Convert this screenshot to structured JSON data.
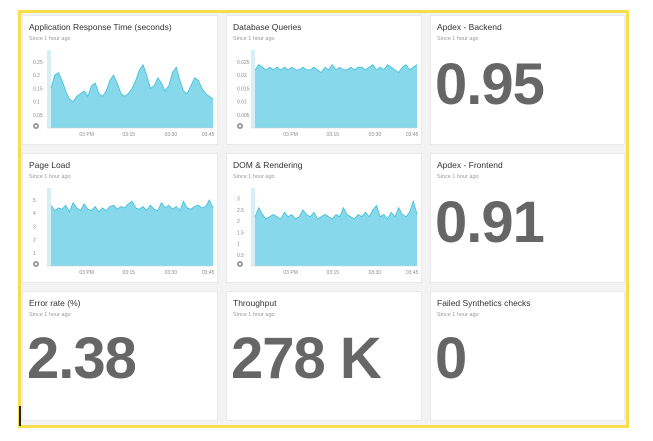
{
  "colors": {
    "area_fill": "#86d8ea",
    "area_stroke": "#2fb9d8",
    "frame": "#f6df4a",
    "big_number": "#666666",
    "gear": "#9a9a9a"
  },
  "widgets": [
    {
      "id": "app-response",
      "title": "Application Response Time (seconds)",
      "subtitle": "Since 1 hour ago",
      "kind": "chart"
    },
    {
      "id": "db-queries",
      "title": "Database Queries",
      "subtitle": "Since 1 hour ago",
      "kind": "chart"
    },
    {
      "id": "apdex-backend",
      "title": "Apdex - Backend",
      "subtitle": "Since 1 hour ago",
      "kind": "number",
      "value": "0.95"
    },
    {
      "id": "page-load",
      "title": "Page Load",
      "subtitle": "Since 1 hour ago",
      "kind": "chart"
    },
    {
      "id": "dom-rendering",
      "title": "DOM & Rendering",
      "subtitle": "Since 1 hour ago",
      "kind": "chart"
    },
    {
      "id": "apdex-frontend",
      "title": "Apdex - Frontend",
      "subtitle": "Since 1 hour ago",
      "kind": "number",
      "value": "0.91"
    },
    {
      "id": "error-rate",
      "title": "Error rate (%)",
      "subtitle": "Since 1 hour ago",
      "kind": "number",
      "value": "2.38"
    },
    {
      "id": "throughput",
      "title": "Throughput",
      "subtitle": "Since 1 hour ago",
      "kind": "number",
      "value": "278 K"
    },
    {
      "id": "failed-synthetics",
      "title": "Failed Synthetics checks",
      "subtitle": "Since 1 hour ago",
      "kind": "number",
      "value": "0"
    }
  ],
  "chart_data": [
    {
      "type": "area",
      "widget": "app-response",
      "x_ticks": [
        "03 PM",
        "03:15",
        "03:30",
        "03:45"
      ],
      "y_ticks": [
        "0.25",
        "0.2",
        "0.15",
        "0.1",
        "0.05"
      ],
      "ylim": [
        0,
        0.28
      ],
      "values": [
        0.15,
        0.2,
        0.21,
        0.18,
        0.14,
        0.11,
        0.1,
        0.12,
        0.13,
        0.14,
        0.12,
        0.16,
        0.17,
        0.13,
        0.12,
        0.14,
        0.18,
        0.2,
        0.17,
        0.13,
        0.12,
        0.13,
        0.15,
        0.18,
        0.22,
        0.24,
        0.2,
        0.15,
        0.16,
        0.19,
        0.17,
        0.14,
        0.16,
        0.21,
        0.23,
        0.18,
        0.14,
        0.13,
        0.16,
        0.19,
        0.18,
        0.15,
        0.13,
        0.12,
        0.11
      ]
    },
    {
      "type": "area",
      "widget": "db-queries",
      "x_ticks": [
        "03 PM",
        "03:15",
        "03:30",
        "03:45"
      ],
      "y_ticks": [
        "0.025",
        "0.02",
        "0.015",
        "0.01",
        "0.005"
      ],
      "ylim": [
        0,
        0.028
      ],
      "values": [
        0.022,
        0.024,
        0.023,
        0.022,
        0.023,
        0.022,
        0.023,
        0.022,
        0.023,
        0.022,
        0.023,
        0.022,
        0.022,
        0.023,
        0.022,
        0.022,
        0.023,
        0.022,
        0.021,
        0.023,
        0.022,
        0.024,
        0.022,
        0.023,
        0.022,
        0.022,
        0.023,
        0.022,
        0.023,
        0.023,
        0.022,
        0.023,
        0.024,
        0.022,
        0.023,
        0.022,
        0.024,
        0.023,
        0.022,
        0.021,
        0.023,
        0.024,
        0.022,
        0.023,
        0.024
      ]
    },
    {
      "type": "area",
      "widget": "page-load",
      "x_ticks": [
        "03 PM",
        "03:15",
        "03:30",
        "03:45"
      ],
      "y_ticks": [
        "5",
        "4",
        "3",
        "2",
        "1"
      ],
      "ylim": [
        0,
        5.6
      ],
      "values": [
        4.6,
        4.2,
        4.4,
        4.3,
        4.6,
        4.1,
        4.8,
        4.4,
        4.2,
        4.7,
        4.3,
        4.2,
        4.5,
        4.1,
        4.4,
        4.2,
        4.5,
        4.6,
        4.3,
        4.5,
        4.4,
        4.7,
        4.9,
        4.4,
        4.3,
        4.5,
        4.2,
        4.6,
        4.3,
        4.2,
        4.8,
        4.4,
        4.6,
        4.3,
        4.5,
        4.2,
        4.9,
        4.4,
        4.3,
        4.5,
        4.6,
        4.4,
        4.5,
        5.0,
        4.4
      ]
    },
    {
      "type": "area",
      "widget": "dom-rendering",
      "x_ticks": [
        "03 PM",
        "03:15",
        "03:30",
        "03:45"
      ],
      "y_ticks": [
        "3",
        "2.5",
        "2",
        "1.5",
        "1",
        "0.5"
      ],
      "ylim": [
        0,
        3.3
      ],
      "values": [
        2.2,
        2.6,
        2.3,
        2.1,
        2.2,
        2.3,
        2.2,
        2.1,
        2.4,
        2.2,
        2.3,
        2.1,
        2.2,
        2.5,
        2.3,
        2.2,
        2.4,
        2.1,
        2.2,
        2.3,
        2.2,
        2.1,
        2.3,
        2.2,
        2.6,
        2.3,
        2.2,
        2.1,
        2.3,
        2.2,
        2.4,
        2.2,
        2.5,
        2.7,
        2.2,
        2.3,
        2.1,
        2.4,
        2.2,
        2.6,
        2.3,
        2.2,
        2.4,
        2.9,
        2.3
      ]
    }
  ]
}
